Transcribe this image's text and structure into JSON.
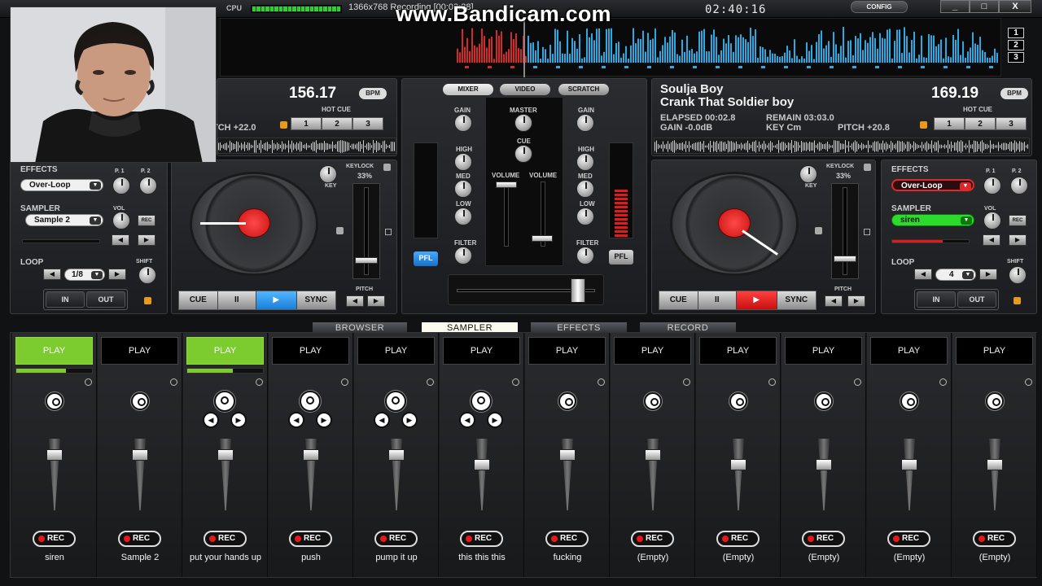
{
  "topbar": {
    "cpu_label": "CPU",
    "recording_info": "1366x768    Recording [00:03:38]",
    "watermark": "www.Bandicam.com",
    "clock": "02:40:16",
    "config_label": "CONFIG",
    "window_buttons": [
      "_",
      "□",
      "X"
    ]
  },
  "overview": {
    "deck_numbers": [
      "1",
      "2",
      "3"
    ]
  },
  "left_deck": {
    "bpm": "156.17",
    "bpm_unit": "BPM",
    "hot_cue_label": "HOT CUE",
    "hot_cues": [
      "1",
      "2",
      "3"
    ],
    "pitch": "TCH +22.0",
    "effects_label": "EFFECTS",
    "p1": "P. 1",
    "p2": "P. 2",
    "effect_selected": "Over-Loop",
    "sampler_label": "SAMPLER",
    "vol_label": "VOL",
    "sampler_selected": "Sample 2",
    "rec_btn": "REC",
    "loop_label": "LOOP",
    "shift_label": "SHIFT",
    "loop_value": "1/8",
    "in_label": "IN",
    "out_label": "OUT",
    "key_label": "KEY",
    "keylock_label": "KEYLOCK",
    "keylock_pct": "33%",
    "pitch_label": "PITCH",
    "transport": [
      "CUE",
      "II",
      "▶",
      "SYNC"
    ]
  },
  "right_deck": {
    "artist": "Soulja Boy",
    "title": "Crank That Soldier boy",
    "bpm": "169.19",
    "bpm_unit": "BPM",
    "elapsed": "ELAPSED 00:02.8",
    "remain": "REMAIN 03:03.0",
    "gain": "GAIN -0.0dB",
    "key": "KEY Cm",
    "pitch": "PITCH +20.8",
    "hot_cue_label": "HOT CUE",
    "hot_cues": [
      "1",
      "2",
      "3"
    ],
    "effects_label": "EFFECTS",
    "p1": "P. 1",
    "p2": "P. 2",
    "effect_selected": "Over-Loop",
    "sampler_label": "SAMPLER",
    "vol_label": "VOL",
    "sampler_selected": "siren",
    "rec_btn": "REC",
    "loop_label": "LOOP",
    "shift_label": "SHIFT",
    "loop_value": "4",
    "in_label": "IN",
    "out_label": "OUT",
    "key_label": "KEY",
    "keylock_label": "KEYLOCK",
    "keylock_pct": "33%",
    "pitch_label": "PITCH",
    "transport": [
      "CUE",
      "II",
      "▶",
      "SYNC"
    ]
  },
  "mixer": {
    "tabs": [
      "MIXER",
      "VIDEO",
      "SCRATCH"
    ],
    "gain": "GAIN",
    "master": "MASTER",
    "cue": "CUE",
    "high": "HIGH",
    "med": "MED",
    "low": "LOW",
    "filter": "FILTER",
    "volume": "VOLUME",
    "pfl": "PFL"
  },
  "bottom_tabs": [
    "BROWSER",
    "SAMPLER",
    "EFFECTS",
    "RECORD"
  ],
  "sampler": {
    "play_label": "PLAY",
    "rec_label": "REC",
    "slots": [
      {
        "name": "siren",
        "active": true,
        "progress": 0.66,
        "volume": 0.9
      },
      {
        "name": "Sample 2",
        "active": false,
        "progress": 0,
        "volume": 0.9
      },
      {
        "name": "put your hands up",
        "active": true,
        "progress": 0.6,
        "volume": 0.9
      },
      {
        "name": "push",
        "active": false,
        "progress": 0,
        "volume": 0.9
      },
      {
        "name": "pump it up",
        "active": false,
        "progress": 0,
        "volume": 0.9
      },
      {
        "name": "this this this",
        "active": false,
        "progress": 0,
        "volume": 0.75
      },
      {
        "name": "fucking",
        "active": false,
        "progress": 0,
        "volume": 0.9
      },
      {
        "name": "(Empty)",
        "active": false,
        "progress": 0,
        "volume": 0.9
      },
      {
        "name": "(Empty)",
        "active": false,
        "progress": 0,
        "volume": 0.75
      },
      {
        "name": "(Empty)",
        "active": false,
        "progress": 0,
        "volume": 0.75
      },
      {
        "name": "(Empty)",
        "active": false,
        "progress": 0,
        "volume": 0.75
      },
      {
        "name": "(Empty)",
        "active": false,
        "progress": 0,
        "volume": 0.75
      }
    ]
  },
  "colors": {
    "accent_green": "#7ccc30",
    "play_blue": "#1e8fe8",
    "play_red": "#e51919"
  }
}
